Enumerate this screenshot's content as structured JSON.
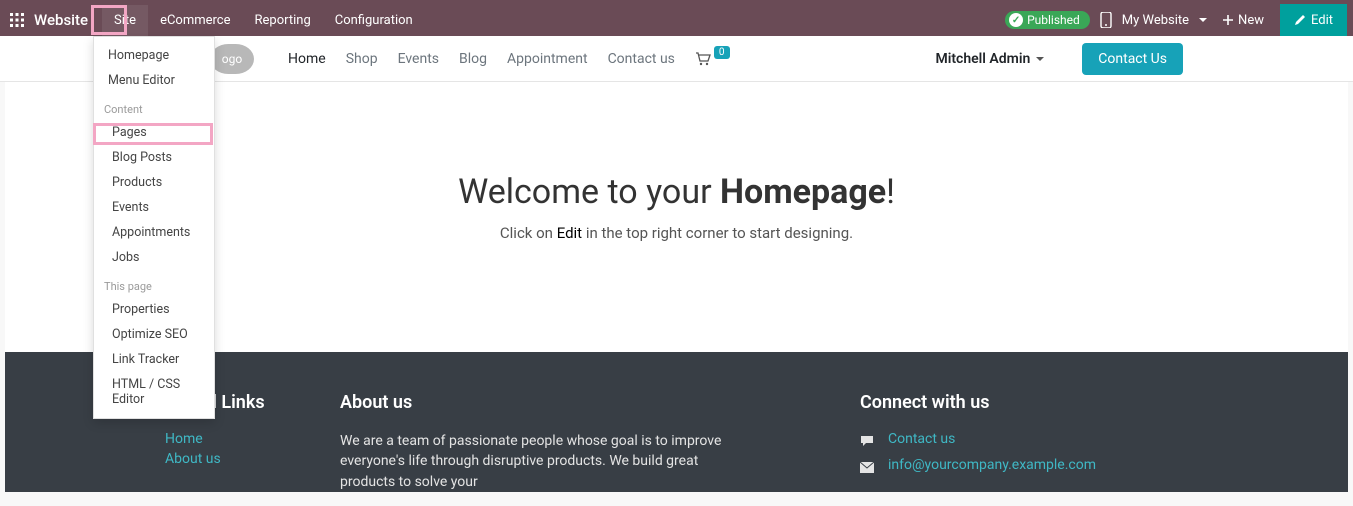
{
  "menubar": {
    "brand": "Website",
    "items": [
      "Site",
      "eCommerce",
      "Reporting",
      "Configuration"
    ],
    "published_label": "Published",
    "site_select": "My Website",
    "new_label": "New",
    "edit_label": "Edit"
  },
  "dropdown": {
    "section_top": [
      "Homepage",
      "Menu Editor"
    ],
    "header_content": "Content",
    "section_content": [
      "Pages",
      "Blog Posts",
      "Products",
      "Events",
      "Appointments",
      "Jobs"
    ],
    "header_thispage": "This page",
    "section_thispage": [
      "Properties",
      "Optimize SEO",
      "Link Tracker",
      "HTML / CSS Editor"
    ]
  },
  "navbar": {
    "logo_text": "ogo",
    "links": [
      "Home",
      "Shop",
      "Events",
      "Blog",
      "Appointment",
      "Contact us"
    ],
    "cart_count": "0",
    "user_name": "Mitchell Admin",
    "contact_btn": "Contact Us"
  },
  "hero": {
    "title_prefix": "Welcome to your ",
    "title_bold": "Homepage",
    "title_suffix": "!",
    "sub_prefix": "Click on ",
    "sub_edit": "Edit",
    "sub_suffix": " in the top right corner to start designing."
  },
  "footer": {
    "useful_heading": "Useful Links",
    "useful_links": [
      "Home",
      "About us"
    ],
    "about_heading": "About us",
    "about_text": "We are a team of passionate people whose goal is to improve everyone's life through disruptive products. We build great products to solve your",
    "connect_heading": "Connect with us",
    "contact_link": "Contact us",
    "email": "info@yourcompany.example.com"
  },
  "highlights": {
    "site_menu": true,
    "blog_posts": true
  }
}
